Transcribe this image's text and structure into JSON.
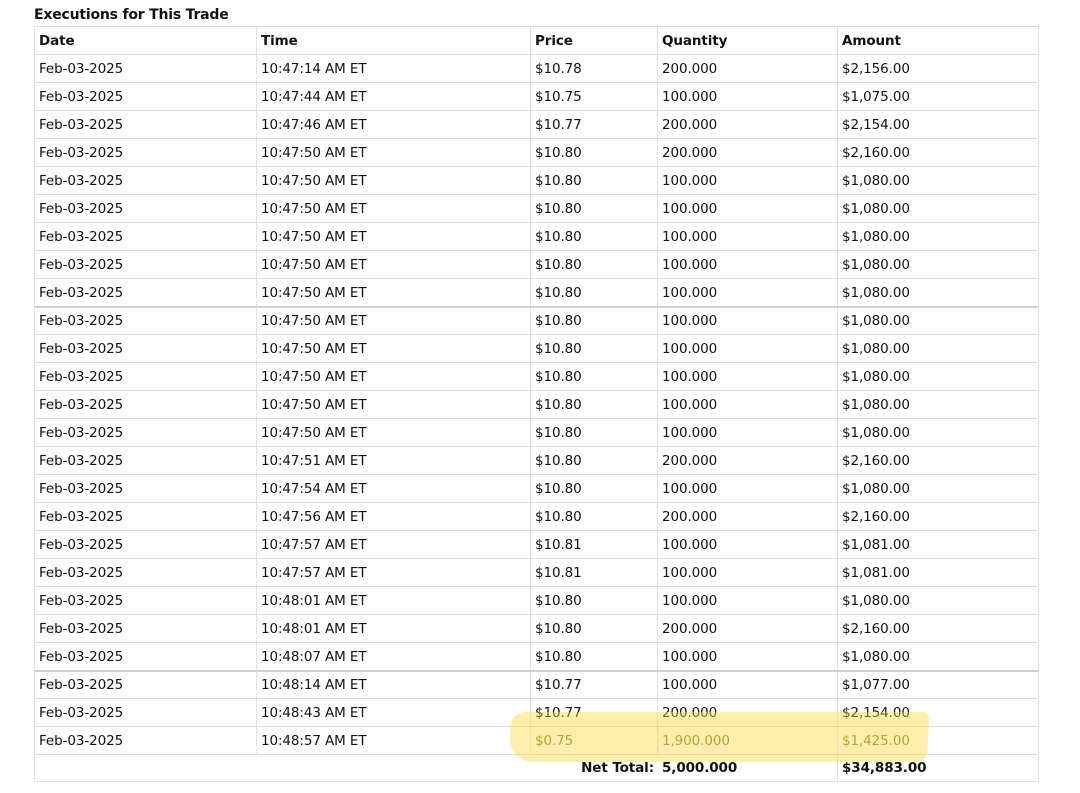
{
  "title": "Executions for This Trade",
  "columns": {
    "date": "Date",
    "time": "Time",
    "price": "Price",
    "quantity": "Quantity",
    "amount": "Amount"
  },
  "rows": [
    {
      "date": "Feb-03-2025",
      "time": "10:47:14 AM ET",
      "price": "$10.78",
      "quantity": "200.000",
      "amount": "$2,156.00"
    },
    {
      "date": "Feb-03-2025",
      "time": "10:47:44 AM ET",
      "price": "$10.75",
      "quantity": "100.000",
      "amount": "$1,075.00"
    },
    {
      "date": "Feb-03-2025",
      "time": "10:47:46 AM ET",
      "price": "$10.77",
      "quantity": "200.000",
      "amount": "$2,154.00"
    },
    {
      "date": "Feb-03-2025",
      "time": "10:47:50 AM ET",
      "price": "$10.80",
      "quantity": "200.000",
      "amount": "$2,160.00"
    },
    {
      "date": "Feb-03-2025",
      "time": "10:47:50 AM ET",
      "price": "$10.80",
      "quantity": "100.000",
      "amount": "$1,080.00"
    },
    {
      "date": "Feb-03-2025",
      "time": "10:47:50 AM ET",
      "price": "$10.80",
      "quantity": "100.000",
      "amount": "$1,080.00"
    },
    {
      "date": "Feb-03-2025",
      "time": "10:47:50 AM ET",
      "price": "$10.80",
      "quantity": "100.000",
      "amount": "$1,080.00"
    },
    {
      "date": "Feb-03-2025",
      "time": "10:47:50 AM ET",
      "price": "$10.80",
      "quantity": "100.000",
      "amount": "$1,080.00"
    },
    {
      "date": "Feb-03-2025",
      "time": "10:47:50 AM ET",
      "price": "$10.80",
      "quantity": "100.000",
      "amount": "$1,080.00"
    },
    {
      "date": "Feb-03-2025",
      "time": "10:47:50 AM ET",
      "price": "$10.80",
      "quantity": "100.000",
      "amount": "$1,080.00"
    },
    {
      "date": "Feb-03-2025",
      "time": "10:47:50 AM ET",
      "price": "$10.80",
      "quantity": "100.000",
      "amount": "$1,080.00"
    },
    {
      "date": "Feb-03-2025",
      "time": "10:47:50 AM ET",
      "price": "$10.80",
      "quantity": "100.000",
      "amount": "$1,080.00"
    },
    {
      "date": "Feb-03-2025",
      "time": "10:47:50 AM ET",
      "price": "$10.80",
      "quantity": "100.000",
      "amount": "$1,080.00"
    },
    {
      "date": "Feb-03-2025",
      "time": "10:47:50 AM ET",
      "price": "$10.80",
      "quantity": "100.000",
      "amount": "$1,080.00"
    },
    {
      "date": "Feb-03-2025",
      "time": "10:47:51 AM ET",
      "price": "$10.80",
      "quantity": "200.000",
      "amount": "$2,160.00"
    },
    {
      "date": "Feb-03-2025",
      "time": "10:47:54 AM ET",
      "price": "$10.80",
      "quantity": "100.000",
      "amount": "$1,080.00"
    },
    {
      "date": "Feb-03-2025",
      "time": "10:47:56 AM ET",
      "price": "$10.80",
      "quantity": "200.000",
      "amount": "$2,160.00"
    },
    {
      "date": "Feb-03-2025",
      "time": "10:47:57 AM ET",
      "price": "$10.81",
      "quantity": "100.000",
      "amount": "$1,081.00"
    },
    {
      "date": "Feb-03-2025",
      "time": "10:47:57 AM ET",
      "price": "$10.81",
      "quantity": "100.000",
      "amount": "$1,081.00"
    },
    {
      "date": "Feb-03-2025",
      "time": "10:48:01 AM ET",
      "price": "$10.80",
      "quantity": "100.000",
      "amount": "$1,080.00"
    },
    {
      "date": "Feb-03-2025",
      "time": "10:48:01 AM ET",
      "price": "$10.80",
      "quantity": "200.000",
      "amount": "$2,160.00"
    },
    {
      "date": "Feb-03-2025",
      "time": "10:48:07 AM ET",
      "price": "$10.80",
      "quantity": "100.000",
      "amount": "$1,080.00"
    },
    {
      "date": "Feb-03-2025",
      "time": "10:48:14 AM ET",
      "price": "$10.77",
      "quantity": "100.000",
      "amount": "$1,077.00"
    },
    {
      "date": "Feb-03-2025",
      "time": "10:48:43 AM ET",
      "price": "$10.77",
      "quantity": "200.000",
      "amount": "$2,154.00"
    },
    {
      "date": "Feb-03-2025",
      "time": "10:48:57 AM ET",
      "price": "$0.75",
      "quantity": "1,900.000",
      "amount": "$1,425.00",
      "highlighted": true
    }
  ],
  "totals": {
    "label": "Net Total:",
    "quantity": "5,000.000",
    "amount": "$34,883.00"
  },
  "colors": {
    "highlight": "#ffd63c",
    "highlight_text": "#8a7a1a"
  }
}
